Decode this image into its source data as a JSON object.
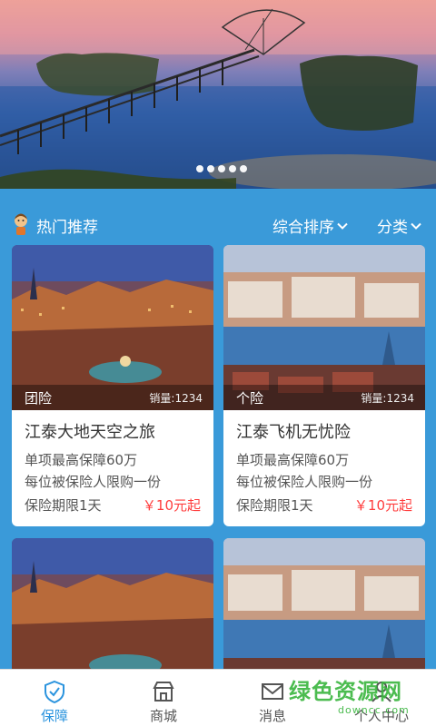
{
  "banner": {
    "dots_count": 5,
    "active_dot": 0
  },
  "section": {
    "title": "热门推荐",
    "sort_label": "综合排序",
    "category_label": "分类"
  },
  "cards": [
    {
      "type": "团险",
      "sales": "销量:1234",
      "title": "江泰大地天空之旅",
      "line1": "单项最高保障60万",
      "line2": "每位被保险人限购一份",
      "term": "保险期限1天",
      "price": "￥10元起"
    },
    {
      "type": "个险",
      "sales": "销量:1234",
      "title": "江泰飞机无忧险",
      "line1": "单项最高保障60万",
      "line2": "每位被保险人限购一份",
      "term": "保险期限1天",
      "price": "￥10元起"
    }
  ],
  "nav": {
    "items": [
      {
        "label": "保障",
        "icon": "shield-icon",
        "active": true
      },
      {
        "label": "商城",
        "icon": "store-icon",
        "active": false
      },
      {
        "label": "消息",
        "icon": "mail-icon",
        "active": false
      },
      {
        "label": "个人中心",
        "icon": "user-icon",
        "active": false
      }
    ]
  },
  "watermark": {
    "text": "绿色资源网",
    "sub": "downcc.com"
  },
  "colors": {
    "background": "#3a9ad9",
    "accent": "#2b94de",
    "price": "#ff3d3d",
    "watermark": "#39b53e"
  }
}
